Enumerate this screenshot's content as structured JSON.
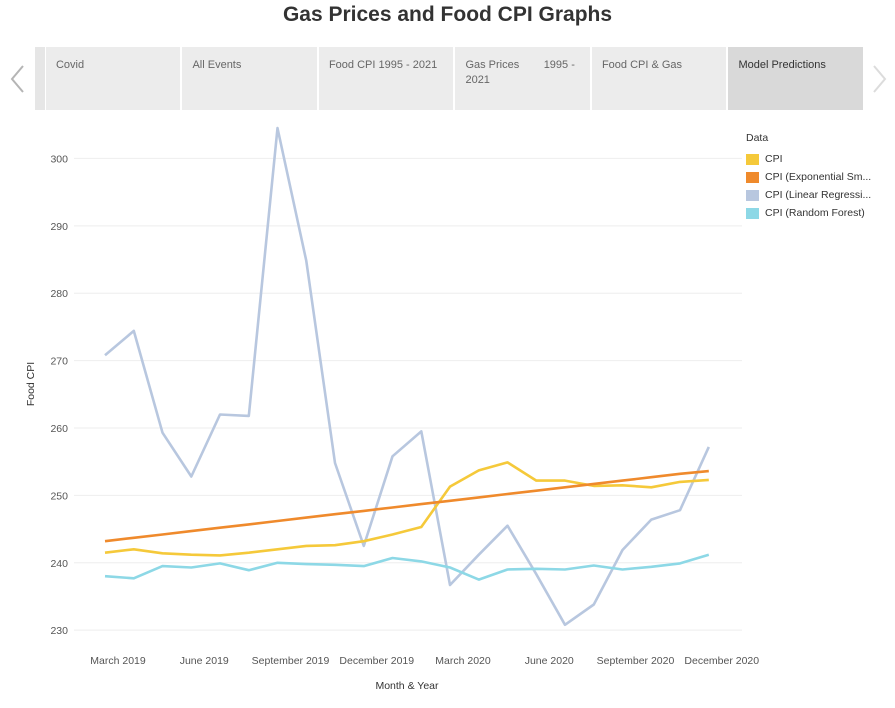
{
  "page": {
    "title": "Gas Prices and Food CPI Graphs"
  },
  "tabs": [
    {
      "label": "Covid",
      "active": false
    },
    {
      "label": "All Events",
      "active": false
    },
    {
      "label": "Food CPI   1995 - 2021",
      "active": false
    },
    {
      "label": "Gas Prices        1995 - 2021",
      "active": false
    },
    {
      "label": "Food CPI & Gas",
      "active": false
    },
    {
      "label": "Model Predictions",
      "active": true
    }
  ],
  "nav": {
    "prev_icon": "chevron-left-icon",
    "next_icon": "chevron-right-icon"
  },
  "legend": {
    "title": "Data",
    "items": [
      {
        "label": "CPI",
        "color": "#f5c93a"
      },
      {
        "label": "CPI (Exponential Sm...",
        "color": "#ef8a2c"
      },
      {
        "label": "CPI (Linear Regressi...",
        "color": "#b8c7df"
      },
      {
        "label": "CPI (Random Forest)",
        "color": "#8dd8e6"
      }
    ]
  },
  "chart_data": {
    "type": "line",
    "xlabel": "Month & Year",
    "ylabel": "Food CPI",
    "x_tick_labels": [
      "March 2019",
      "June 2019",
      "September 2019",
      "December 2019",
      "March 2020",
      "June 2020",
      "September 2020",
      "December 2020"
    ],
    "x_tick_index": [
      0,
      3,
      6,
      9,
      12,
      15,
      18,
      21
    ],
    "x": [
      "2019-03",
      "2019-04",
      "2019-05",
      "2019-06",
      "2019-07",
      "2019-08",
      "2019-09",
      "2019-10",
      "2019-11",
      "2019-12",
      "2020-01",
      "2020-02",
      "2020-03",
      "2020-04",
      "2020-05",
      "2020-06",
      "2020-07",
      "2020-08",
      "2020-09",
      "2020-10",
      "2020-11",
      "2020-12",
      "2021-01"
    ],
    "y_ticks": [
      230,
      240,
      250,
      260,
      270,
      280,
      290,
      300
    ],
    "ylim": [
      227.5,
      306
    ],
    "grid": true,
    "series": [
      {
        "name": "CPI",
        "color": "#f5c93a",
        "values": [
          241.5,
          242.0,
          241.4,
          241.2,
          241.1,
          241.5,
          242.0,
          242.5,
          242.6,
          243.2,
          244.2,
          245.3,
          251.3,
          253.7,
          254.9,
          252.2,
          252.2,
          251.4,
          251.5,
          251.2,
          252.0,
          252.3
        ]
      },
      {
        "name": "CPI (Exponential Sm...",
        "color": "#ef8a2c",
        "values": [
          243.2,
          243.7,
          244.2,
          244.7,
          245.2,
          245.7,
          246.2,
          246.7,
          247.2,
          247.7,
          248.2,
          248.7,
          249.2,
          249.7,
          250.2,
          250.7,
          251.2,
          251.7,
          252.2,
          252.7,
          253.2,
          253.6
        ]
      },
      {
        "name": "CPI (Linear Regressi...",
        "color": "#b8c7df",
        "values": [
          270.8,
          274.4,
          259.3,
          252.8,
          262.0,
          261.8,
          304.5,
          284.8,
          254.8,
          242.5,
          255.8,
          259.5,
          236.7,
          241.2,
          245.5,
          238.3,
          230.8,
          233.8,
          241.9,
          246.4,
          247.8,
          257.2
        ]
      },
      {
        "name": "CPI (Random Forest)",
        "color": "#8dd8e6",
        "values": [
          238.0,
          237.7,
          239.5,
          239.3,
          239.9,
          238.9,
          240.0,
          239.8,
          239.7,
          239.5,
          240.7,
          240.2,
          239.3,
          237.5,
          239.0,
          239.1,
          239.0,
          239.6,
          239.0,
          239.4,
          239.9,
          241.2
        ]
      }
    ]
  }
}
